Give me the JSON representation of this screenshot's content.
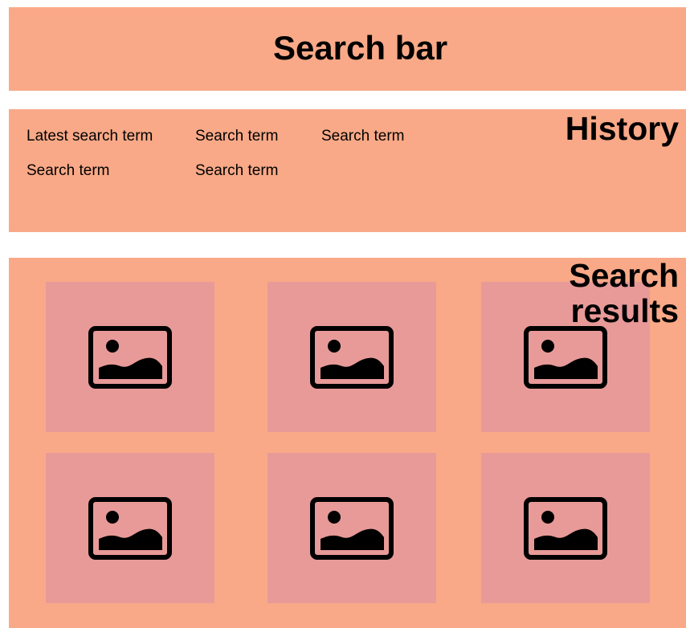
{
  "search_bar": {
    "label": "Search bar"
  },
  "history": {
    "label": "History",
    "terms": [
      "Latest search term",
      "Search term",
      "Search term",
      "Search term",
      "Search term"
    ]
  },
  "results": {
    "label": "Search results",
    "items": [
      {
        "icon": "image-icon"
      },
      {
        "icon": "image-icon"
      },
      {
        "icon": "image-icon"
      },
      {
        "icon": "image-icon"
      },
      {
        "icon": "image-icon"
      },
      {
        "icon": "image-icon"
      }
    ]
  },
  "colors": {
    "panel": "#f9a987",
    "tile": "#e89a98",
    "text": "#000000"
  }
}
